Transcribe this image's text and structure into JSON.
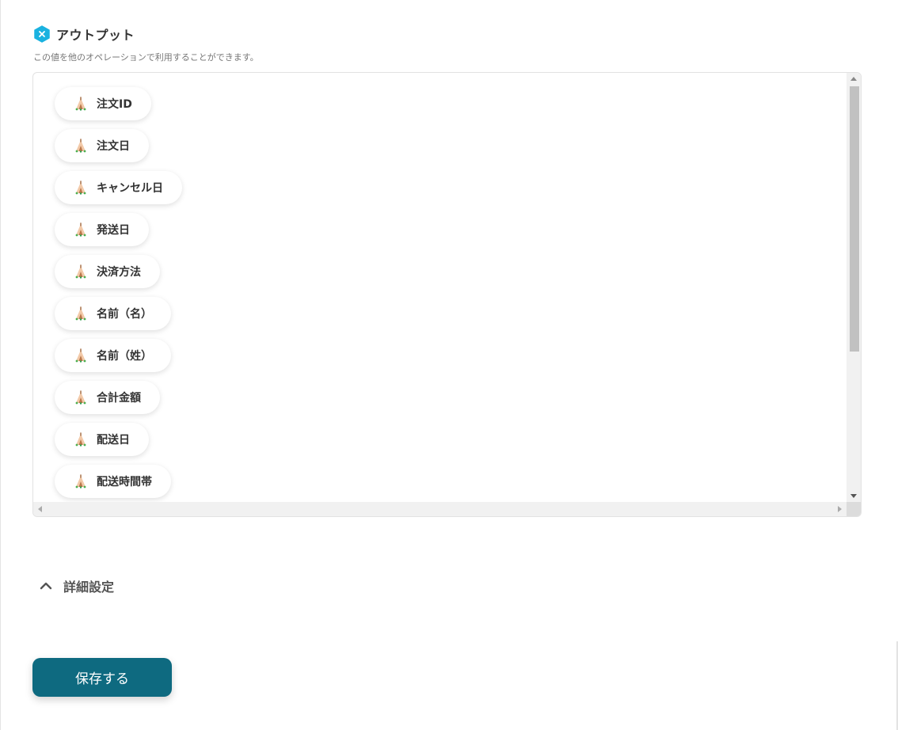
{
  "output_section": {
    "title": "アウトプット",
    "description": "この値を他のオペレーションで利用することができます。",
    "items": [
      {
        "label": "注文ID"
      },
      {
        "label": "注文日"
      },
      {
        "label": "キャンセル日"
      },
      {
        "label": "発送日"
      },
      {
        "label": "決済方法"
      },
      {
        "label": "名前（名）"
      },
      {
        "label": "名前（姓）"
      },
      {
        "label": "合計金額"
      },
      {
        "label": "配送日"
      },
      {
        "label": "配送時間帯"
      }
    ]
  },
  "detail_settings": {
    "label": "詳細設定",
    "expanded": true
  },
  "actions": {
    "save_label": "保存する"
  },
  "colors": {
    "accent": "#0e6a80",
    "icon_cyan": "#1ab2e0"
  },
  "icons": {
    "header": "hexagon-x-icon",
    "item": "variable-icon",
    "toggle": "chevron-up-icon"
  }
}
